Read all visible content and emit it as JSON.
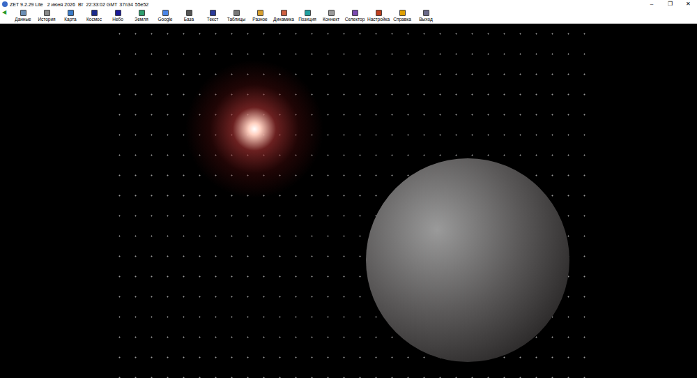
{
  "window": {
    "app": "ZET 9.2.29 Lite",
    "date": "2 июня 2026",
    "weekday": "Вт",
    "time": "22:33:02 GMT",
    "lat": "37n34",
    "lon": "55e52",
    "controls": [
      "–",
      "❐",
      "✕"
    ]
  },
  "toolbar": {
    "back": "◀",
    "items": [
      {
        "label": "Данные",
        "color": "#6b8fb5"
      },
      {
        "label": "История",
        "color": "#8a8a8a"
      },
      {
        "label": "Карта",
        "color": "#3a7bc8"
      },
      {
        "label": "Космос",
        "color": "#1a2a8a"
      },
      {
        "label": "Небо",
        "color": "#1a1a9a"
      },
      {
        "label": "Земля",
        "color": "#2f9e6e"
      },
      {
        "label": "Google",
        "color": "#4a86e8"
      },
      {
        "label": "База",
        "color": "#555555"
      },
      {
        "label": "Текст",
        "color": "#2a3a9a"
      },
      {
        "label": "Таблицы",
        "color": "#777777"
      },
      {
        "label": "Разное",
        "color": "#d8a030"
      },
      {
        "label": "Динамика",
        "color": "#d06040"
      },
      {
        "label": "Позиция",
        "color": "#20a0a0"
      },
      {
        "label": "Коннект",
        "color": "#9a9a9a"
      },
      {
        "label": "Селектор",
        "color": "#7a4ab0"
      },
      {
        "label": "Настройка",
        "color": "#c04020"
      },
      {
        "label": "Справка",
        "color": "#e0a000"
      },
      {
        "label": "Выход",
        "color": "#6a6a8a"
      }
    ]
  }
}
